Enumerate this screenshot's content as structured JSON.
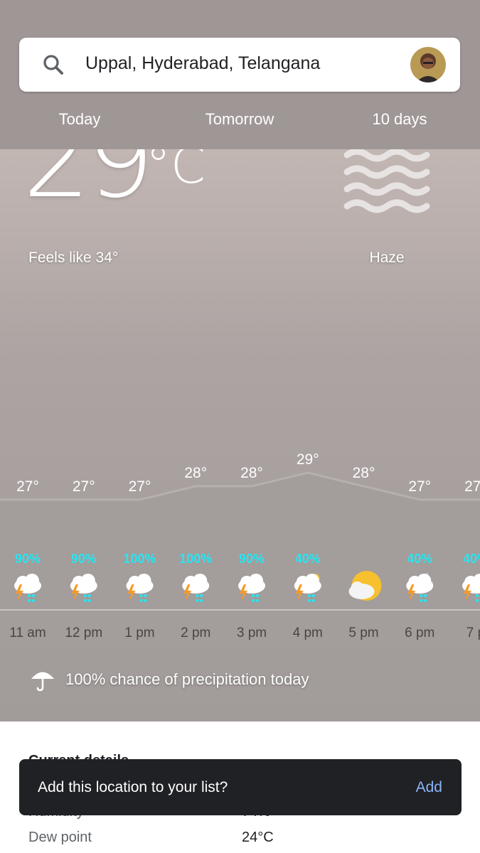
{
  "search": {
    "location": "Uppal, Hyderabad, Telangana"
  },
  "tabs": [
    "Today",
    "Tomorrow",
    "10 days"
  ],
  "current": {
    "temp": "29",
    "unit": "°C",
    "feels_like": "Feels like 34°",
    "condition": "Haze",
    "condition_icon": "haze-icon"
  },
  "hourly": [
    {
      "time": "11 am",
      "temp": 27,
      "precip": "90%",
      "icon": "thunderstorm-rain-icon"
    },
    {
      "time": "12 pm",
      "temp": 27,
      "precip": "90%",
      "icon": "thunderstorm-rain-icon"
    },
    {
      "time": "1 pm",
      "temp": 27,
      "precip": "100%",
      "icon": "thunderstorm-rain-icon"
    },
    {
      "time": "2 pm",
      "temp": 28,
      "precip": "100%",
      "icon": "thunderstorm-rain-icon"
    },
    {
      "time": "3 pm",
      "temp": 28,
      "precip": "90%",
      "icon": "thunderstorm-rain-icon"
    },
    {
      "time": "4 pm",
      "temp": 29,
      "precip": "40%",
      "icon": "thunderstorm-sun-icon"
    },
    {
      "time": "5 pm",
      "temp": 28,
      "precip": "",
      "icon": "partly-cloudy-icon"
    },
    {
      "time": "6 pm",
      "temp": 27,
      "precip": "40%",
      "icon": "thunderstorm-moon-icon"
    },
    {
      "time": "7 p",
      "temp": 27,
      "precip": "40%",
      "icon": "thunderstorm-moon-icon"
    }
  ],
  "temp_suffix": "°",
  "precip_summary": "100% chance of precipitation today",
  "details": {
    "title": "Current details",
    "rows": [
      {
        "label": "Humidity",
        "value": "74%"
      },
      {
        "label": "Dew point",
        "value": "24°C"
      }
    ]
  },
  "snackbar": {
    "message": "Add this location to your list?",
    "action": "Add"
  },
  "colors": {
    "header_bg": "#9f9796",
    "precip_text": "#26e5f2",
    "snackbar_bg": "#202124",
    "snackbar_action": "#8ab4f8"
  }
}
